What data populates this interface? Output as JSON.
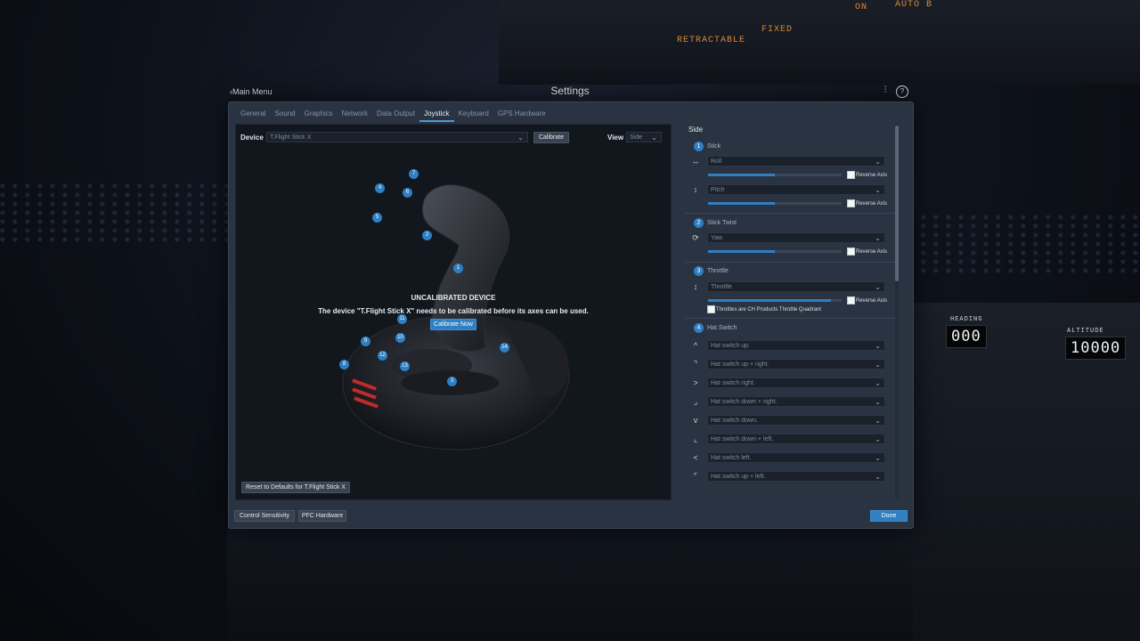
{
  "window": {
    "title": "Settings",
    "back_label": "Main Menu"
  },
  "tabs": [
    {
      "label": "General"
    },
    {
      "label": "Sound"
    },
    {
      "label": "Graphics"
    },
    {
      "label": "Network"
    },
    {
      "label": "Data Output"
    },
    {
      "label": "Joystick"
    },
    {
      "label": "Keyboard"
    },
    {
      "label": "GPS Hardware"
    }
  ],
  "active_tab": "Joystick",
  "device": {
    "label": "Device",
    "value": "T.Flight Stick X",
    "calibrate_label": "Calibrate"
  },
  "view": {
    "label": "View",
    "value": "Side"
  },
  "uncalibrated": {
    "heading": "UNCALIBRATED DEVICE",
    "text": "The device \"T.Flight Stick X\" needs to be calibrated before its axes can be used.",
    "button": "Calibrate Now"
  },
  "reset_label": "Reset to Defaults for T.Flight Stick X",
  "joystick_buttons": [
    "1",
    "2",
    "3",
    "4",
    "5",
    "6",
    "7",
    "8",
    "9",
    "10",
    "11",
    "12",
    "13",
    "14"
  ],
  "right_panel": {
    "title": "Side",
    "sections": [
      {
        "num": "1",
        "title": "Stick",
        "axes": [
          {
            "icon": "↔",
            "value": "Roll",
            "level": 0.5,
            "reverse": "Reverse Axis"
          },
          {
            "icon": "↕",
            "value": "Pitch",
            "level": 0.5,
            "reverse": "Reverse Axis"
          }
        ]
      },
      {
        "num": "2",
        "title": "Stick Twist",
        "axes": [
          {
            "icon": "⟳",
            "value": "Yaw",
            "level": 0.5,
            "reverse": "Reverse Axis"
          }
        ]
      },
      {
        "num": "3",
        "title": "Throttle",
        "axes": [
          {
            "icon": "↕",
            "value": "Throttle",
            "level": 0.92,
            "reverse": "Reverse Axis"
          }
        ],
        "extra_checkbox": "Throttles are CH Products Throttle Quadrant"
      },
      {
        "num": "4",
        "title": "Hat Switch"
      }
    ],
    "hat_items": [
      {
        "icon": "^",
        "value": "Hat switch up."
      },
      {
        "icon": "⌝",
        "value": "Hat switch up + right."
      },
      {
        "icon": ">",
        "value": "Hat switch right."
      },
      {
        "icon": "⌟",
        "value": "Hat switch down + right."
      },
      {
        "icon": "v",
        "value": "Hat switch down."
      },
      {
        "icon": "⌞",
        "value": "Hat switch down + left."
      },
      {
        "icon": "<",
        "value": "Hat switch left."
      },
      {
        "icon": "⌜",
        "value": "Hat switch up + left."
      }
    ]
  },
  "footer": {
    "control_sensitivity": "Control Sensitivity",
    "pfc_hardware": "PFC Hardware",
    "done": "Done"
  },
  "cockpit": {
    "retractable": "RETRACTABLE",
    "fixed": "FIXED",
    "on_auto": "ON",
    "auto": "AUTO B",
    "heading": "HEADING",
    "altitude": "ALTITUDE",
    "heading_value": "000",
    "altitude_value": "10000"
  },
  "colors": {
    "accent": "#2f7fc2",
    "dialog_bg": "#2a3341",
    "pane_bg": "#12161d"
  }
}
